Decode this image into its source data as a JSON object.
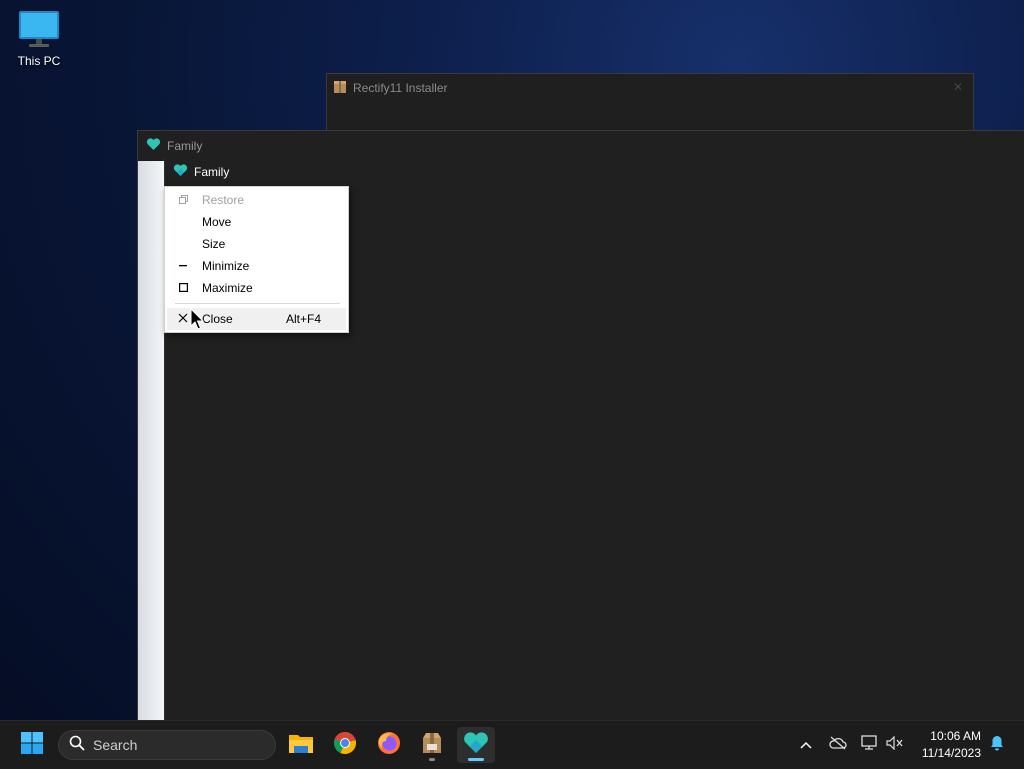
{
  "desktop": {
    "icons": [
      {
        "label": "This PC",
        "icon": "computer-icon"
      }
    ]
  },
  "windows": {
    "installer": {
      "title": "Rectify11 Installer",
      "icon": "package-icon"
    },
    "family_outer": {
      "title": "Family",
      "icon": "heart-icon"
    },
    "family_inner": {
      "title": "Family",
      "icon": "heart-icon"
    }
  },
  "context_menu": {
    "items": [
      {
        "label": "Restore",
        "glyph": "restore-icon",
        "disabled": true
      },
      {
        "label": "Move"
      },
      {
        "label": "Size"
      },
      {
        "label": "Minimize",
        "glyph": "minimize-icon"
      },
      {
        "label": "Maximize",
        "glyph": "maximize-icon"
      },
      {
        "label": "Close",
        "glyph": "close-icon",
        "shortcut": "Alt+F4"
      }
    ]
  },
  "taskbar": {
    "search_placeholder": "Search",
    "apps": [
      "start-icon",
      "file-explorer-icon",
      "chrome-icon",
      "firefox-icon",
      "installer-icon",
      "family-icon"
    ],
    "clock": {
      "time": "10:06 AM",
      "date": "11/14/2023"
    }
  },
  "colors": {
    "accent": "#2ec4b6",
    "indicator": "#60cdff",
    "desktop_bg": "#0b1a45"
  }
}
